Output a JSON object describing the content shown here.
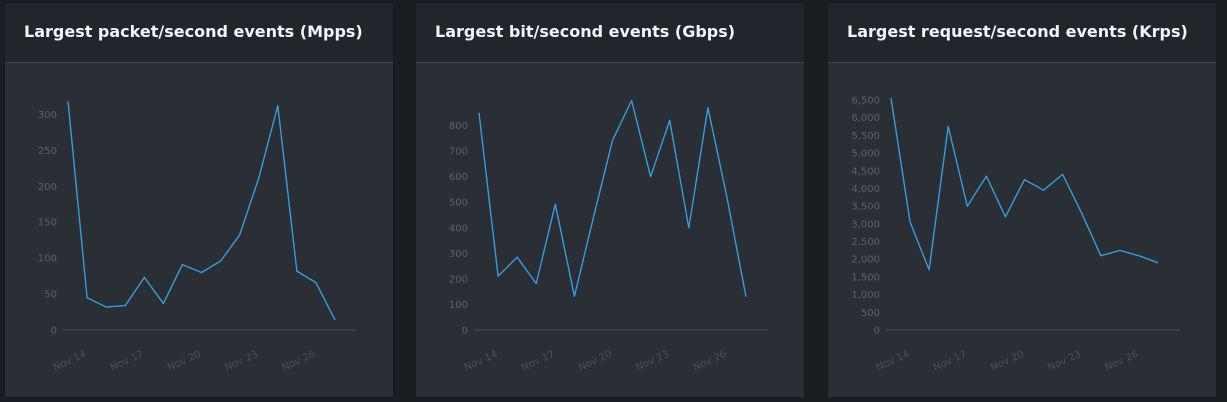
{
  "panels": [
    {
      "title": "Largest packet/second events (Mpps)",
      "chart_data": {
        "type": "line",
        "x": [
          "Nov 13",
          "Nov 14",
          "Nov 15",
          "Nov 16",
          "Nov 17",
          "Nov 18",
          "Nov 19",
          "Nov 20",
          "Nov 21",
          "Nov 22",
          "Nov 23",
          "Nov 24",
          "Nov 25",
          "Nov 26",
          "Nov 27"
        ],
        "series": [
          {
            "values": [
              318,
              45,
              32,
              34,
              73,
              37,
              91,
              80,
              96,
              132,
              211,
              312,
              82,
              66,
              14
            ]
          }
        ],
        "ylim": [
          0,
          320
        ],
        "yticks": [
          0,
          50,
          100,
          150,
          200,
          250,
          300
        ],
        "ytick_labels": [
          "0",
          "50",
          "100",
          "150",
          "200",
          "250",
          "300"
        ],
        "xtick_labels": [
          "Nov 14",
          "Nov 17",
          "Nov 20",
          "Nov 23",
          "Nov 26"
        ],
        "xtick_positions": [
          1,
          4,
          7,
          10,
          13
        ],
        "line_color": "#3a9bd9",
        "grid": false
      }
    },
    {
      "title": "Largest bit/second events (Gbps)",
      "chart_data": {
        "type": "line",
        "x": [
          "Nov 13",
          "Nov 14",
          "Nov 15",
          "Nov 16",
          "Nov 17",
          "Nov 18",
          "Nov 19",
          "Nov 20",
          "Nov 21",
          "Nov 22",
          "Nov 23",
          "Nov 24",
          "Nov 25",
          "Nov 26",
          "Nov 27"
        ],
        "series": [
          {
            "values": [
              850,
              210,
              285,
              182,
              492,
              132,
              440,
              742,
              898,
              600,
              820,
              400,
              870,
              520,
              130
            ]
          }
        ],
        "ylim": [
          0,
          900
        ],
        "yticks": [
          0,
          100,
          200,
          300,
          400,
          500,
          600,
          700,
          800
        ],
        "ytick_labels": [
          "0",
          "100",
          "200",
          "300",
          "400",
          "500",
          "600",
          "700",
          "800"
        ],
        "xtick_labels": [
          "Nov 14",
          "Nov 17",
          "Nov 20",
          "Nov 23",
          "Nov 26"
        ],
        "xtick_positions": [
          1,
          4,
          7,
          10,
          13
        ],
        "line_color": "#3a9bd9",
        "grid": false
      }
    },
    {
      "title": "Largest request/second events (Krps)",
      "chart_data": {
        "type": "line",
        "x": [
          "Nov 13",
          "Nov 14",
          "Nov 15",
          "Nov 16",
          "Nov 17",
          "Nov 18",
          "Nov 19",
          "Nov 20",
          "Nov 21",
          "Nov 22",
          "Nov 23",
          "Nov 24",
          "Nov 25",
          "Nov 26",
          "Nov 27"
        ],
        "series": [
          {
            "values": [
              6550,
              3050,
              1700,
              5750,
              3500,
              4350,
              3200,
              4250,
              3950,
              4400,
              3300,
              2100,
              2250,
              2100,
              1900
            ]
          }
        ],
        "ylim": [
          0,
          6500
        ],
        "yticks": [
          0,
          500,
          1000,
          1500,
          2000,
          2500,
          3000,
          3500,
          4000,
          4500,
          5000,
          5500,
          6000,
          6500
        ],
        "ytick_labels": [
          "0",
          "500",
          "1,000",
          "1,500",
          "2,000",
          "2,500",
          "3,000",
          "3,500",
          "4,000",
          "4,500",
          "5,000",
          "5,500",
          "6,000",
          "6,500"
        ],
        "xtick_labels": [
          "Nov 14",
          "Nov 17",
          "Nov 20",
          "Nov 23",
          "Nov 26"
        ],
        "xtick_positions": [
          1,
          4,
          7,
          10,
          13
        ],
        "line_color": "#3a9bd9",
        "grid": false
      }
    }
  ]
}
